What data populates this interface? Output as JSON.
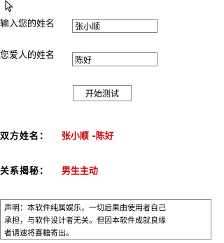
{
  "form": {
    "name_label": "输入您的姓名",
    "name_value": "张小顺",
    "lover_label": "您爱人的姓名",
    "lover_value": "陈好",
    "test_button_label": "开始测试"
  },
  "result": {
    "pair_label": "双方姓名：",
    "pair_value": "张小顺 -陈好",
    "reveal_label": "关系揭秘：",
    "reveal_value": "男生主动",
    "value_color": "#cc0000"
  },
  "disclaimer": {
    "text": "声明：本软件纯属娱乐，一切后果由使用者自己\n承担，与软件设计者无关。但因本软件成就良缘\n者请速将喜糖寄出。"
  },
  "icons": {
    "cursor": "mouse-pointer-icon"
  }
}
